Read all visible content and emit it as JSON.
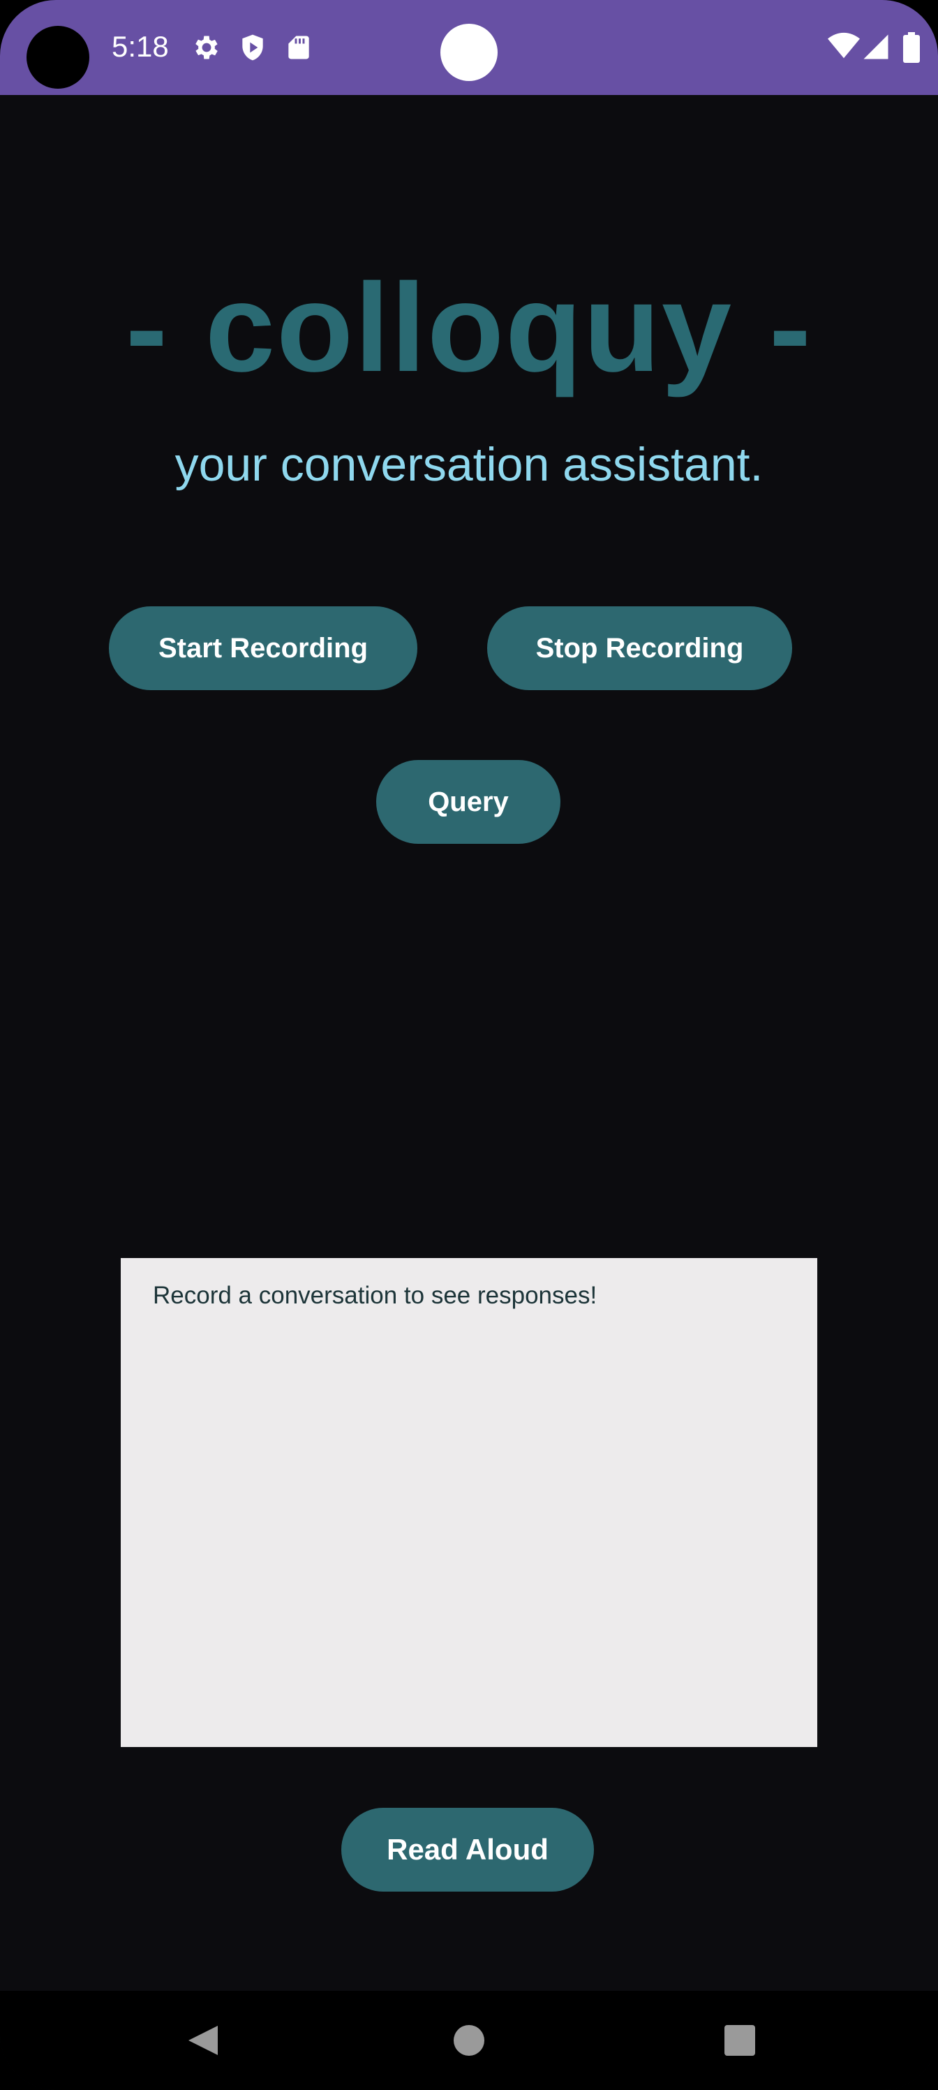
{
  "status_bar": {
    "time": "5:18",
    "icons": [
      "settings-icon",
      "play-protect-icon",
      "sd-card-icon"
    ],
    "right_icons": [
      "wifi-icon",
      "signal-icon",
      "battery-icon"
    ],
    "color": "#6750a4"
  },
  "app": {
    "title": "- colloquy -",
    "subtitle": "your conversation assistant."
  },
  "buttons": {
    "start_recording": "Start Recording",
    "stop_recording": "Stop Recording",
    "query": "Query",
    "read_aloud": "Read Aloud"
  },
  "response": {
    "text": "Record a conversation to see responses!"
  },
  "nav_bar": {
    "items": [
      "back-icon",
      "home-icon",
      "recents-icon"
    ]
  },
  "colors": {
    "background": "#0c0c0f",
    "accent": "#2d6870",
    "title": "#2a6a73",
    "subtitle": "#8fd8ee",
    "response_bg": "#edebec"
  }
}
